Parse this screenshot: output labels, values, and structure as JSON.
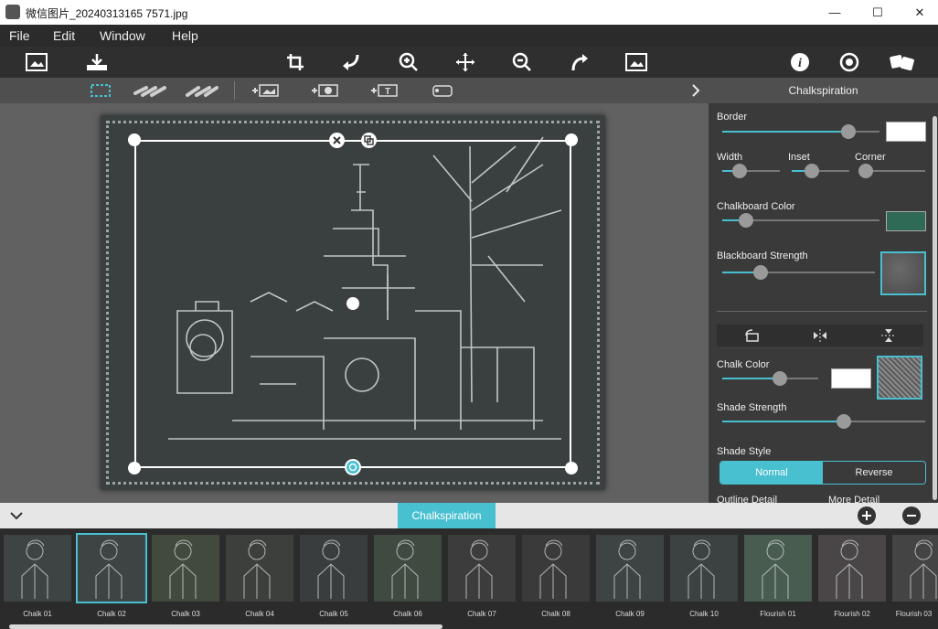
{
  "window": {
    "title": "微信图片_20240313165 7571.jpg",
    "minimize": "—",
    "maximize": "☐",
    "close": "✕"
  },
  "menu": [
    "File",
    "Edit",
    "Window",
    "Help"
  ],
  "toolbar": {
    "icons": [
      "open-image-icon",
      "save-icon",
      "crop-icon",
      "undo-icon",
      "zoom-in-icon",
      "pan-icon",
      "zoom-out-icon",
      "redo-icon",
      "fit-image-icon",
      "info-icon",
      "settings-icon",
      "random-icon"
    ]
  },
  "subtoolbar": {
    "icons": [
      "select-rect-icon",
      "brush-add-icon",
      "brush-remove-icon",
      "add-image-icon",
      "add-star-icon",
      "add-text-icon",
      "add-shape-icon",
      "expand-panel-icon"
    ]
  },
  "panel": {
    "title": "Chalkspiration",
    "border_label": "Border",
    "border_value": 0.8,
    "border_color": "#ffffff",
    "width_label": "Width",
    "width_value": 0.3,
    "inset_label": "Inset",
    "inset_value": 0.35,
    "corner_label": "Corner",
    "corner_value": 0.1,
    "chalkboard_color_label": "Chalkboard Color",
    "chalkboard_color_value": 0.15,
    "chalkboard_color": "#2e6a55",
    "blackboard_strength_label": "Blackboard Strength",
    "blackboard_strength_value": 0.25,
    "chalk_color_label": "Chalk Color",
    "chalk_color_value": 0.6,
    "chalk_color": "#ffffff",
    "shade_strength_label": "Shade Strength",
    "shade_strength_value": 0.6,
    "shade_style_label": "Shade Style",
    "shade_style_options": [
      "Normal",
      "Reverse"
    ],
    "shade_style_selected": "Normal",
    "outline_detail_label": "Outline Detail",
    "more_detail_label": "More Detail"
  },
  "strip": {
    "active_tab": "Chalkspiration",
    "selected": "Chalk 02",
    "items": [
      "Chalk 01",
      "Chalk 02",
      "Chalk 03",
      "Chalk 04",
      "Chalk 05",
      "Chalk 06",
      "Chalk 07",
      "Chalk 08",
      "Chalk 09",
      "Chalk 10",
      "Flourish 01",
      "Flourish 02",
      "Flourish 03"
    ]
  },
  "colors": {
    "accent": "#49c0d0"
  }
}
